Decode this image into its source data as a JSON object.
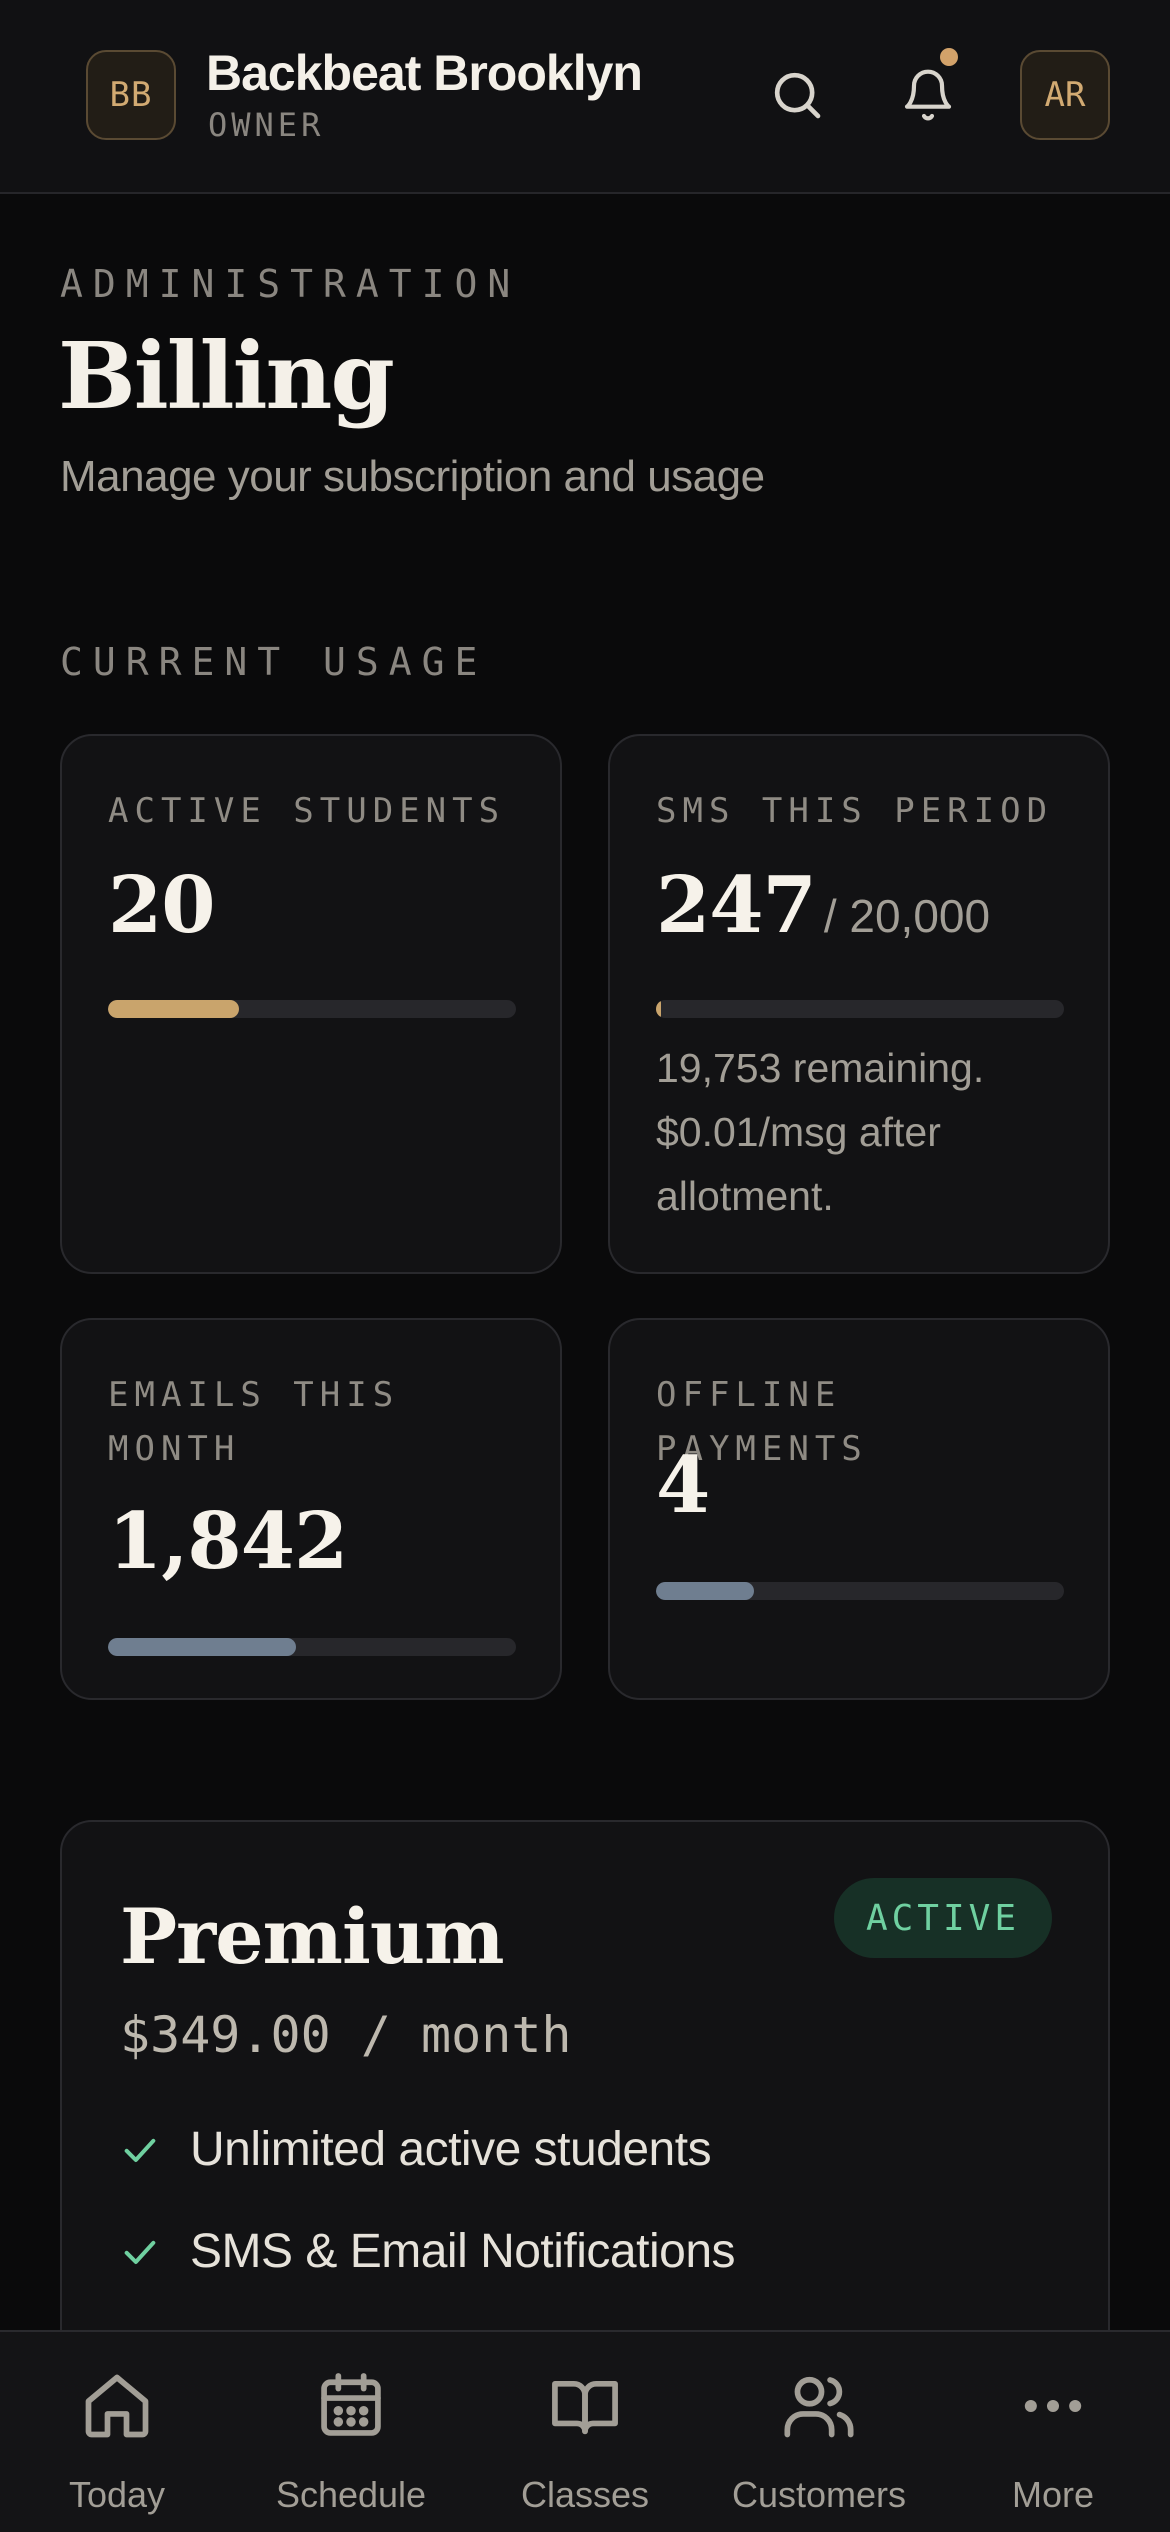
{
  "header": {
    "org_initials": "BB",
    "org_name": "Backbeat Brooklyn",
    "org_role": "OWNER",
    "search_icon": "search-icon",
    "bell_icon": "bell-icon",
    "has_notification": true,
    "avatar_initials": "AR"
  },
  "page": {
    "eyebrow": "ADMINISTRATION",
    "title": "Billing",
    "subtitle": "Manage your subscription and usage"
  },
  "usage": {
    "section_label": "CURRENT USAGE",
    "cards": [
      {
        "label": "ACTIVE STUDENTS",
        "value": "20",
        "suffix": "",
        "note": "",
        "fill_fraction": 0.32,
        "color": "#c9a46c"
      },
      {
        "label": "SMS THIS PERIOD",
        "value": "247",
        "suffix": "/ 20,000",
        "note": "19,753 remaining. $0.01/msg after allotment.",
        "fill_fraction": 0.012,
        "color": "#c9a46c"
      },
      {
        "label": "EMAILS THIS MONTH",
        "value": "1,842",
        "suffix": "",
        "note": "",
        "fill_fraction": 0.46,
        "color": "#6f7e90"
      },
      {
        "label": "OFFLINE PAYMENTS",
        "value": "4",
        "suffix": "",
        "note": "",
        "fill_fraction": 0.24,
        "color": "#6f7e90"
      }
    ]
  },
  "plan": {
    "name": "Premium",
    "status": "ACTIVE",
    "price": "$349.00 / month",
    "features": [
      "Unlimited active students",
      "SMS & Email Notifications"
    ],
    "check_icon": "check-icon"
  },
  "tabs": [
    {
      "label": "Today",
      "icon": "home-icon"
    },
    {
      "label": "Schedule",
      "icon": "calendar-icon"
    },
    {
      "label": "Classes",
      "icon": "book-icon"
    },
    {
      "label": "Customers",
      "icon": "users-icon"
    },
    {
      "label": "More",
      "icon": "more-icon"
    }
  ],
  "colors": {
    "background": "#0a0a0b",
    "accent_gold": "#c9a46c",
    "accent_slate": "#6f7e90",
    "success": "#6fd0a0"
  }
}
